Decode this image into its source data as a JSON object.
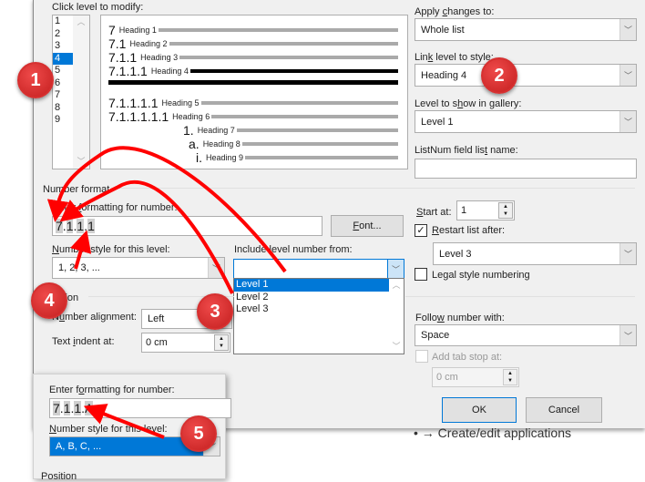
{
  "dialog": {
    "click_level_label": "Click level to modify:",
    "levels": [
      "1",
      "2",
      "3",
      "4",
      "5",
      "6",
      "7",
      "8",
      "9"
    ],
    "selected_level": "4",
    "preview": [
      {
        "num": "7",
        "heading": "Heading 1"
      },
      {
        "num": "7.1",
        "heading": "Heading 2"
      },
      {
        "num": "7.1.1",
        "heading": "Heading 3"
      },
      {
        "num": "7.1.1.1",
        "heading": "Heading 4"
      },
      {
        "num": "7.1.1.1.1",
        "heading": "Heading 5"
      },
      {
        "num": "7.1.1.1.1.1",
        "heading": "Heading 6"
      },
      {
        "num": "1.",
        "heading": "Heading 7"
      },
      {
        "num": "a.",
        "heading": "Heading 8"
      },
      {
        "num": "i.",
        "heading": "Heading 9"
      }
    ],
    "apply_changes_label": "Apply changes to:",
    "apply_changes_value": "Whole list",
    "link_level_label": "Link level to style:",
    "link_level_value": "Heading 4",
    "gallery_label": "Level to show in gallery:",
    "gallery_value": "Level 1",
    "listnum_label": "ListNum field list name:",
    "listnum_value": "",
    "number_format_label": "Number format",
    "enter_formatting_label": "Enter formatting for number:",
    "formatting_value": "7.1.1.1",
    "font_button": "Font...",
    "number_style_label": "Number style for this level:",
    "number_style_value": "1, 2, 3, ...",
    "include_level_label": "Include level number from:",
    "include_level_value": "",
    "include_level_options": [
      "Level 1",
      "Level 2",
      "Level 3"
    ],
    "include_level_selected": "Level 1",
    "start_at_label": "Start at:",
    "start_at_value": "1",
    "restart_label": "Restart list after:",
    "restart_checked": true,
    "restart_value": "Level 3",
    "legal_label": "Legal style numbering",
    "legal_checked": false,
    "position_label": "Position",
    "alignment_label": "Number alignment:",
    "alignment_value": "Left",
    "indent_label": "Text indent at:",
    "indent_value": "0 cm",
    "follow_label": "Follow number with:",
    "follow_value": "Space",
    "tabstop_label": "Add tab stop at:",
    "tabstop_checked": false,
    "tabstop_value": "0 cm",
    "ok": "OK",
    "cancel": "Cancel"
  },
  "inset": {
    "enter_formatting_label": "Enter formatting for number:",
    "formatting_value": "7.1.1.A",
    "number_style_label": "Number style for this level:",
    "number_style_value": "A, B, C, ...",
    "position_label": "Position"
  },
  "background_doc_text": "• → Create/edit applications",
  "badges": [
    "1",
    "2",
    "3",
    "4",
    "5"
  ],
  "annotation_color": "#ff0000"
}
